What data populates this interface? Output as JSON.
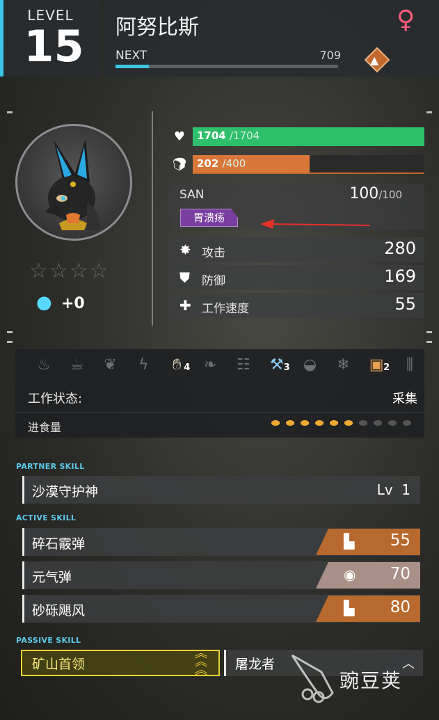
{
  "header": {
    "level_label": "LEVEL",
    "level": "15",
    "name": "阿努比斯",
    "gender_icon": "female-symbol",
    "next_label": "NEXT",
    "next_value": "709",
    "exp_fraction": 0.15,
    "element_icon": "ground-element-icon"
  },
  "portrait": {
    "stars_filled": 0,
    "stars_total": 4,
    "stars_text": "☆☆☆☆",
    "soul_value": "+0"
  },
  "bars": {
    "hp_current": "1704",
    "hp_max": "/1704",
    "hp_fraction": 1.0,
    "food_current": "202",
    "food_max": "/400",
    "food_fraction": 0.505
  },
  "san": {
    "label": "SAN",
    "value": "100",
    "max": "/100",
    "status_tag": "胃溃疡"
  },
  "stats": [
    {
      "icon": "attack-icon",
      "label": "攻击",
      "value": "280"
    },
    {
      "icon": "defense-icon",
      "label": "防御",
      "value": "169"
    },
    {
      "icon": "work-speed-icon",
      "label": "工作速度",
      "value": "55"
    }
  ],
  "work": {
    "icons": [
      {
        "name": "kindling-icon",
        "level": "",
        "active": false
      },
      {
        "name": "watering-icon",
        "level": "",
        "active": false
      },
      {
        "name": "planting-icon",
        "level": "",
        "active": false
      },
      {
        "name": "electricity-icon",
        "level": "",
        "active": false
      },
      {
        "name": "handiwork-icon",
        "level": "4",
        "active": true
      },
      {
        "name": "gathering-icon",
        "level": "",
        "active": false
      },
      {
        "name": "lumbering-icon",
        "level": "",
        "active": false
      },
      {
        "name": "mining-icon",
        "level": "3",
        "active": true
      },
      {
        "name": "medicine-icon",
        "level": "",
        "active": false
      },
      {
        "name": "cooling-icon",
        "level": "",
        "active": false
      },
      {
        "name": "transporting-icon",
        "level": "2",
        "active": true
      },
      {
        "name": "farming-icon",
        "level": "",
        "active": false
      }
    ],
    "status_label": "工作状态:",
    "status_value": "采集",
    "food_label": "进食量",
    "food_on": 6,
    "food_total": 10
  },
  "skills": {
    "partner_label": "PARTNER SKILL",
    "partner_name": "沙漠守护神",
    "partner_level_label": "Lv",
    "partner_level": "1",
    "active_label": "ACTIVE SKILL",
    "active": [
      {
        "name": "碎石霰弹",
        "power": "55",
        "element": "ground",
        "color": "#b8692e"
      },
      {
        "name": "元气弹",
        "power": "70",
        "element": "neutral",
        "color": "#a89088"
      },
      {
        "name": "砂砾飓风",
        "power": "80",
        "element": "ground",
        "color": "#b8692e"
      }
    ],
    "passive_label": "PASSIVE SKILL",
    "passive": [
      {
        "name": "矿山首领",
        "tier": "gold"
      },
      {
        "name": "屠龙者",
        "tier": "normal"
      }
    ]
  },
  "watermark_text": "豌豆荚",
  "colors": {
    "accent_cyan": "#3cc6e6",
    "hp_green": "#2ebf6a",
    "food_orange": "#d9773a",
    "status_purple": "#7a3ea0",
    "gold": "#e8d030"
  }
}
